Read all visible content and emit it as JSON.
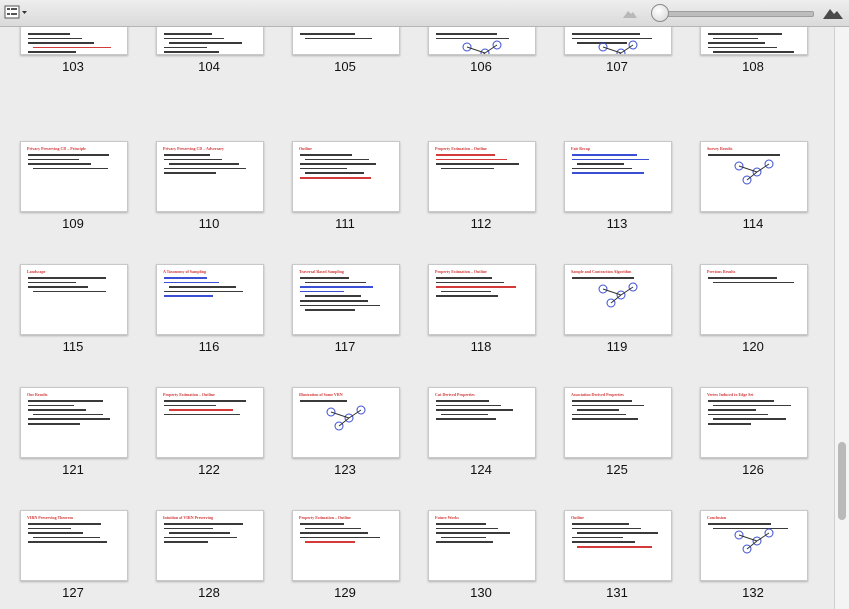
{
  "toolbar": {
    "view_icon": "sidebar-list-icon",
    "zoom_small_icon": "small-mountain-icon",
    "zoom_large_icon": "large-mountain-icon",
    "zoom_level": 0.03
  },
  "colors": {
    "title_red": "#d43a3a",
    "accent_blue": "#3a4fd4"
  },
  "pages": [
    {
      "number": "103",
      "title": "",
      "lines": [
        "",
        "",
        "",
        "r",
        ""
      ]
    },
    {
      "number": "104",
      "title": "",
      "lines": [
        "",
        "",
        "",
        "",
        ""
      ]
    },
    {
      "number": "105",
      "title": "",
      "lines": [
        "",
        ""
      ]
    },
    {
      "number": "106",
      "title": "",
      "lines": [
        "",
        ""
      ],
      "figure": true
    },
    {
      "number": "107",
      "title": "",
      "lines": [
        "",
        "",
        ""
      ],
      "figure": true
    },
    {
      "number": "108",
      "title": "",
      "lines": [
        "",
        "",
        "",
        "",
        ""
      ]
    },
    {
      "number": "109",
      "title": "Privacy Preserving CD – Principle",
      "lines": [
        "",
        "",
        "",
        ""
      ]
    },
    {
      "number": "110",
      "title": "Privacy Preserving CD – Adversary",
      "lines": [
        "",
        "",
        "",
        "",
        ""
      ]
    },
    {
      "number": "111",
      "title": "Outline",
      "lines": [
        "",
        "",
        "",
        "",
        "",
        "r"
      ]
    },
    {
      "number": "112",
      "title": "Property Estimation – Outline",
      "lines": [
        "r",
        "r",
        "",
        ""
      ]
    },
    {
      "number": "113",
      "title": "Fair Recap",
      "lines": [
        "b",
        "b",
        "",
        "",
        "b"
      ]
    },
    {
      "number": "114",
      "title": "Survey Results",
      "lines": [
        ""
      ],
      "figure": true
    },
    {
      "number": "115",
      "title": "Landscape",
      "lines": [
        "",
        "",
        "",
        ""
      ]
    },
    {
      "number": "116",
      "title": "A Taxonomy of Sampling",
      "lines": [
        "b",
        "b",
        "",
        "",
        "b"
      ]
    },
    {
      "number": "117",
      "title": "Traversal Based Sampling",
      "lines": [
        "",
        "",
        "b",
        "b",
        "",
        "",
        "",
        ""
      ]
    },
    {
      "number": "118",
      "title": "Property Estimation – Outline",
      "lines": [
        "",
        "",
        "r",
        "",
        ""
      ]
    },
    {
      "number": "119",
      "title": "Sample and Contraction Algorithm",
      "lines": [
        ""
      ],
      "figure": true
    },
    {
      "number": "120",
      "title": "Previous Results",
      "lines": [
        "",
        ""
      ]
    },
    {
      "number": "121",
      "title": "Our Results",
      "lines": [
        "",
        "",
        "",
        "",
        "",
        ""
      ]
    },
    {
      "number": "122",
      "title": "Property Estimation – Outline",
      "lines": [
        "",
        "",
        "r",
        ""
      ]
    },
    {
      "number": "123",
      "title": "Illustration of Some VRN",
      "lines": [
        ""
      ],
      "figure": true
    },
    {
      "number": "124",
      "title": "Cut Derived Properties",
      "lines": [
        "",
        "",
        "",
        "",
        ""
      ]
    },
    {
      "number": "125",
      "title": "Association Derived Properties",
      "lines": [
        "",
        "",
        "",
        "",
        ""
      ]
    },
    {
      "number": "126",
      "title": "Vertex Induced to Edge Set",
      "lines": [
        "",
        "",
        "",
        "",
        "",
        ""
      ]
    },
    {
      "number": "127",
      "title": "VIRN Preserving Theorem",
      "lines": [
        "",
        "",
        "",
        "",
        ""
      ]
    },
    {
      "number": "128",
      "title": "Intuition of VIRN Preserving",
      "lines": [
        "",
        "",
        "",
        "",
        ""
      ]
    },
    {
      "number": "129",
      "title": "Property Estimation – Outline",
      "lines": [
        "",
        "",
        "",
        "",
        "r"
      ]
    },
    {
      "number": "130",
      "title": "Future Works",
      "lines": [
        "",
        "",
        "",
        "",
        ""
      ]
    },
    {
      "number": "131",
      "title": "Outline",
      "lines": [
        "",
        "",
        "",
        "",
        "",
        "r"
      ]
    },
    {
      "number": "132",
      "title": "Conclusion",
      "lines": [
        "",
        ""
      ],
      "figure": true
    }
  ]
}
